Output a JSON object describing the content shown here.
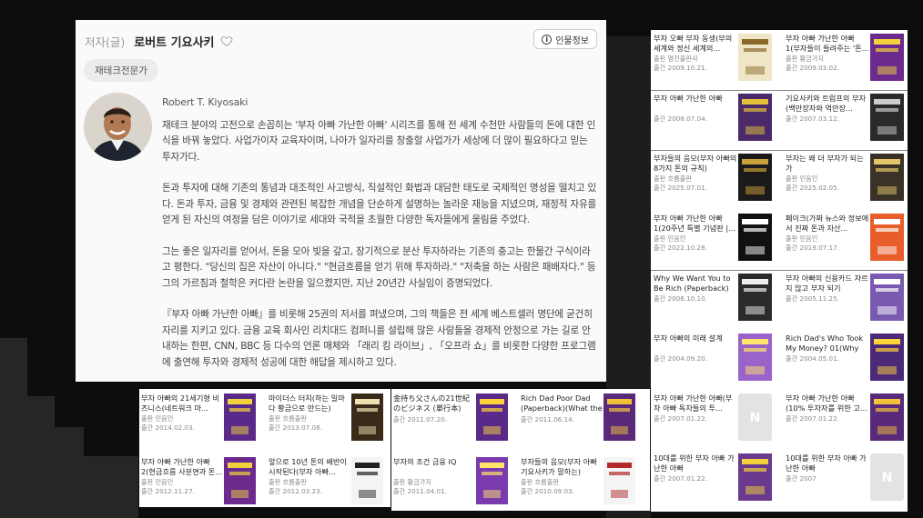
{
  "author": {
    "role": "저자(글)",
    "name": "로버트 기요사키",
    "info_label": "인물정보",
    "info_icon": "info-icon",
    "tag": "재테크전문가",
    "english_name": "Robert T. Kiyosaki",
    "bio": [
      "재테크 분야의 고전으로 손꼽히는 '부자 아빠 가난한 아빠' 시리즈를 통해 전 세계 수천만 사람들의 돈에 대한 인식을 바꿔 놓았다. 사업가이자 교육자이며, 나아가 일자리를 창출할 사업가가 세상에 더 많이 필요하다고 믿는 투자가다.",
      "돈과 투자에 대해 기존의 통념과 대조적인 사고방식, 직설적인 화법과 대담한 태도로 국제적인 명성을 떨치고 있다. 돈과 투자, 금융 및 경제와 관련된 복잡한 개념을 단순하게 설명하는 놀라운 재능을 지녔으며, 재정적 자유를 얻게 된 자신의 여정을 담은 이야기로 세대와 국적을 초월한 다양한 독자들에게 울림을 주었다.",
      "그는 좋은 일자리를 얻어서, 돈을 모아 빚을 갚고, 장기적으로 분산 투자하라는 기존의 충고는 한물간 구식이라고 평한다. \"당신의 집은 자산이 아니다.\" \"현금흐름을 얻기 위해 투자하라.\" \"저축을 하는 사람은 패배자다.\" 등 그의 가르침과 철학은 커다란 논란을 일으켰지만, 지난 20년간 사실임이 증명되었다.",
      "『부자 아빠 가난한 아빠』를 비롯해 25권의 저서를 펴냈으며, 그의 책들은 전 세계 베스트셀러 명단에 굳건히 자리를 지키고 있다. 금융 교육 회사인 리치대드 컴퍼니를 설립해 많은 사람들을 경제적 안정으로 가는 길로 안내하는 한편, CNN, BBC 등 다수의 언론 매체와 「래리 킹 라이브」, 「오프라 쇼」를 비롯한 다양한 프로그램에 출연해 투자와 경제적 성공에 대한 해답을 제시하고 있다."
    ]
  },
  "right_books": [
    {
      "title": "부자 오빠 부자 동생(부의 세계와 정신 세계의...",
      "publisher": "출판 명진출판사",
      "date": "출간 2009.10.21.",
      "color": "#efe6c8",
      "accent": "#8a6a2a"
    },
    {
      "title": "부자 아빠 가난한 아빠 1(부자들이 들려주는 '돈...",
      "publisher": "출판 황금가지",
      "date": "출간 2009.03.02.",
      "color": "#6b2a8e",
      "accent": "#f2d23a"
    },
    {
      "title": "부자 아빠 가난한 아빠",
      "publisher": "",
      "date": "출간 2008.07.04.",
      "color": "#4a2a6a",
      "accent": "#e3c23a"
    },
    {
      "title": "기요사키와 트럼프의 부자(백만장자와 억만장...",
      "publisher": "",
      "date": "출간 2007.03.12.",
      "color": "#2a2a2a",
      "accent": "#cccccc"
    },
    {
      "title": "부자들의 음모(부자 아빠의 8가지 돈의 규칙)",
      "publisher": "출판 흐름출판",
      "date": "출간 2025.07.01.",
      "color": "#1a1a1a",
      "accent": "#c9a13a"
    },
    {
      "title": "부자는 왜 더 부자가 되는가",
      "publisher": "출판 민음인",
      "date": "출간 2025.02.05.",
      "color": "#3a3226",
      "accent": "#e2c46a"
    },
    {
      "title": "부자 아빠 가난한 아빠 1(20주년 특별 기념판 |...",
      "publisher": "출판 민음인",
      "date": "출간 2022.10.28.",
      "color": "#111111",
      "accent": "#ffffff"
    },
    {
      "title": "페이크(가짜 뉴스와 정보에서 진짜 돈과 자산...",
      "publisher": "출판 민음인",
      "date": "출간 2019.07.17.",
      "color": "#e85d2a",
      "accent": "#ffffff"
    },
    {
      "title": "Why We Want You to Be Rich (Paperback)(Two...",
      "publisher": "",
      "date": "출간 2006.10.10.",
      "color": "#2b2b2b",
      "accent": "#f0f0f0"
    },
    {
      "title": "부자 아빠의 신용카드 자르지 않고 부자 되기",
      "publisher": "",
      "date": "출간 2005.11.25.",
      "color": "#7a5ab0",
      "accent": "#ffffff"
    },
    {
      "title": "부자 아빠의 미래 설계",
      "publisher": "",
      "date": "출간 2004.09.20.",
      "color": "#9a63c9",
      "accent": "#ffe66a"
    },
    {
      "title": "Rich Dad's Who Took My Money? 01(Why Slo...",
      "publisher": "",
      "date": "출간 2004.05.01.",
      "color": "#4b2a7a",
      "accent": "#ffd43a"
    },
    {
      "title": "부자 아빠 가난한 아빠(부자 아빠 독자들의 투...",
      "publisher": "",
      "date": "출간 2007.01.22.",
      "color": "#e3e3e3",
      "accent": "#cfcfcf",
      "placeholder": true
    },
    {
      "title": "부자 아빠 가난한 아빠(10% 투자자를 위한 고...",
      "publisher": "",
      "date": "출간 2007.01.22.",
      "color": "#5a2a7a",
      "accent": "#f2c23a"
    },
    {
      "title": "10대를 위한 부자 아빠 가난한 아빠",
      "publisher": "",
      "date": "출간 2007.01.22.",
      "color": "#6a3a8e",
      "accent": "#f2d23a"
    },
    {
      "title": "10대를 위한 부자 아빠 가난한 아빠",
      "publisher": "",
      "date": "출간 2007",
      "color": "#e3e3e3",
      "accent": "#cfcfcf",
      "placeholder": true
    }
  ],
  "bottom_left_books": [
    {
      "title": "부자 아빠의 21세기형 비즈니스(네트워크 마...",
      "publisher": "출판 민음인",
      "date": "출간 2014.02.03.",
      "color": "#5a2a8a",
      "accent": "#f2d23a"
    },
    {
      "title": "마이더스 터치(하는 일마다 황금으로 만드는)",
      "publisher": "출판 흐름출판",
      "date": "출간 2013.07.08.",
      "color": "#3a2a1a",
      "accent": "#f0e0b0"
    },
    {
      "title": "부자 아빠 가난한 아빠 2(현금흐름 사분면과 돈...",
      "publisher": "출판 민음인",
      "date": "출간 2012.11.27.",
      "color": "#6a2a8e",
      "accent": "#f2d23a"
    },
    {
      "title": "앞으로 10년 돈의 배반이 시작된다(부자 아빠...",
      "publisher": "출판 흐름출판",
      "date": "출간 2012.03.23.",
      "color": "#f4f4f4",
      "accent": "#222222"
    }
  ],
  "bottom_right_books": [
    {
      "title": "金持ち父さんの21世紀のビジネス (單行本)(Th...",
      "publisher": "",
      "date": "출간 2011.07.20.",
      "color": "#5a2a8a",
      "accent": "#ffd43a"
    },
    {
      "title": "Rich Dad Poor Dad (Paperback)(What the Rich ...",
      "publisher": "",
      "date": "출간 2011.06.14.",
      "color": "#5a2a7a",
      "accent": "#f2c23a"
    },
    {
      "title": "부자의 조건 금융 IQ",
      "publisher": "출판 황금가지",
      "date": "출간 2011.04.01.",
      "color": "#7a3ab0",
      "accent": "#ffe66a"
    },
    {
      "title": "부자들의 음모(부자 아빠 기요사키가 말하는)",
      "publisher": "출판 흐름출판",
      "date": "출간 2010.09.03.",
      "color": "#f4f4f4",
      "accent": "#b02a2a"
    }
  ]
}
